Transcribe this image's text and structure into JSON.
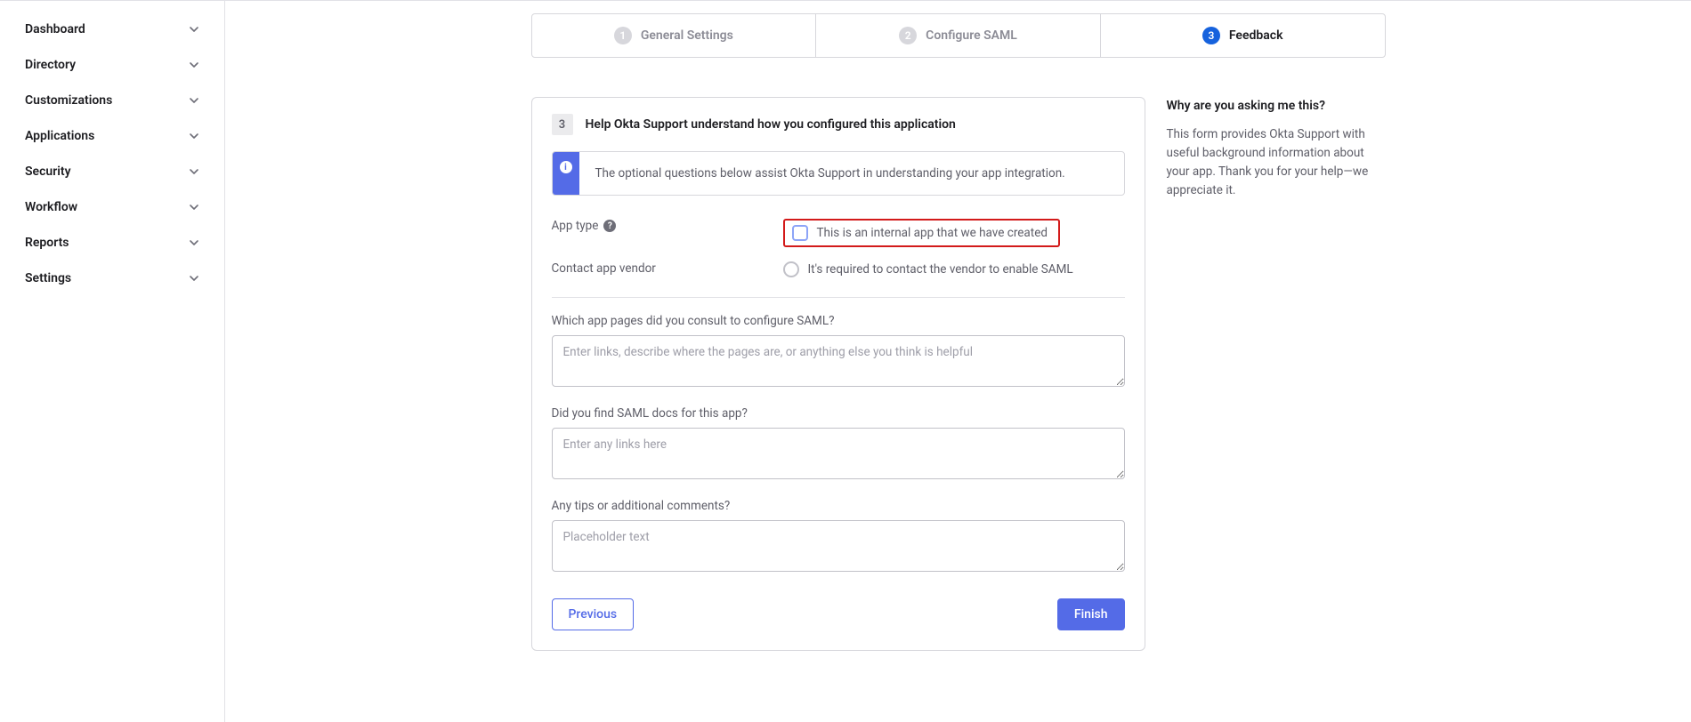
{
  "sidebar": {
    "items": [
      {
        "label": "Dashboard"
      },
      {
        "label": "Directory"
      },
      {
        "label": "Customizations"
      },
      {
        "label": "Applications"
      },
      {
        "label": "Security"
      },
      {
        "label": "Workflow"
      },
      {
        "label": "Reports"
      },
      {
        "label": "Settings"
      }
    ]
  },
  "stepper": {
    "steps": [
      {
        "num": "1",
        "label": "General Settings",
        "active": false
      },
      {
        "num": "2",
        "label": "Configure SAML",
        "active": false
      },
      {
        "num": "3",
        "label": "Feedback",
        "active": true
      }
    ]
  },
  "panel": {
    "step_num": "3",
    "title": "Help Okta Support understand how you configured this application",
    "callout": "The optional questions below assist Okta Support in understanding your app integration.",
    "app_type_label": "App type",
    "app_type_option": "This is an internal app that we have created",
    "contact_vendor_label": "Contact app vendor",
    "contact_vendor_option": "It's required to contact the vendor to enable SAML",
    "q1_label": "Which app pages did you consult to configure SAML?",
    "q1_placeholder": "Enter links, describe where the pages are, or anything else you think is helpful",
    "q2_label": "Did you find SAML docs for this app?",
    "q2_placeholder": "Enter any links here",
    "q3_label": "Any tips or additional comments?",
    "q3_placeholder": "Placeholder text",
    "previous": "Previous",
    "finish": "Finish"
  },
  "aside": {
    "title": "Why are you asking me this?",
    "body": "This form provides Okta Support with useful background information about your app. Thank you for your help—we appreciate it."
  }
}
